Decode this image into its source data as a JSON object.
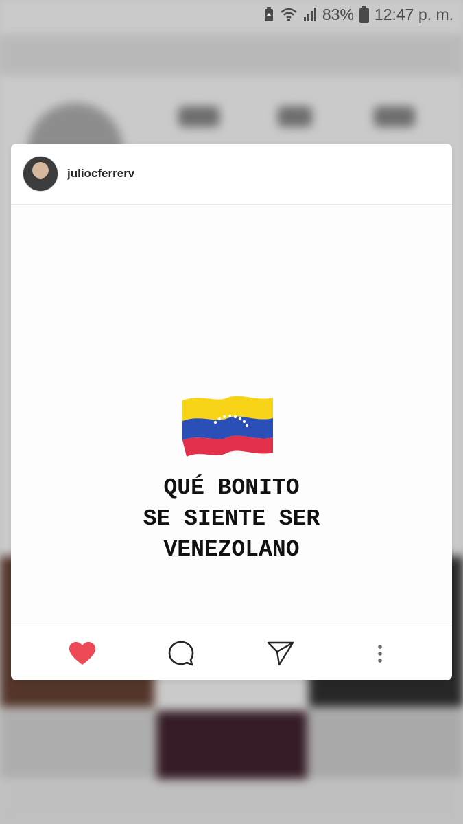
{
  "status_bar": {
    "battery_percent": "83%",
    "time": "12:47 p. m."
  },
  "post": {
    "username": "juliocferrerv",
    "text_lines": [
      "QUÉ BONITO",
      "SE SIENTE SER",
      "VENEZOLANO"
    ],
    "liked": true
  },
  "colors": {
    "like": "#ed4956",
    "flag_yellow": "#f7d417",
    "flag_blue": "#2a4fb6",
    "flag_red": "#e2304a"
  },
  "icons": {
    "like": "heart-icon",
    "comment": "comment-icon",
    "share": "send-icon",
    "more": "more-vertical-icon"
  }
}
